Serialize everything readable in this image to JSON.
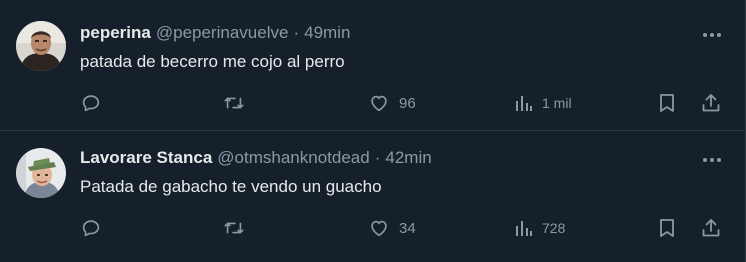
{
  "tweets": [
    {
      "author_name": "peperina",
      "handle": "@peperinavuelve",
      "separator": "·",
      "time": "49min",
      "text": "patada de becerro me cojo al perro",
      "likes": "96",
      "views": "1 mil",
      "avatar_icon": "avatar-photo-man",
      "more_icon": "more-options-icon"
    },
    {
      "author_name": "Lavorare Stanca",
      "handle": "@otmshanknotdead",
      "separator": "·",
      "time": "42min",
      "text": "Patada de gabacho te vendo un guacho",
      "likes": "34",
      "views": "728",
      "avatar_icon": "avatar-photo-man-with-hat",
      "more_icon": "more-options-icon"
    }
  ],
  "colors": {
    "background": "#15202b",
    "primary_text": "#e7e9ea",
    "secondary_text": "#8b98a5",
    "divider": "#2f3a45"
  }
}
